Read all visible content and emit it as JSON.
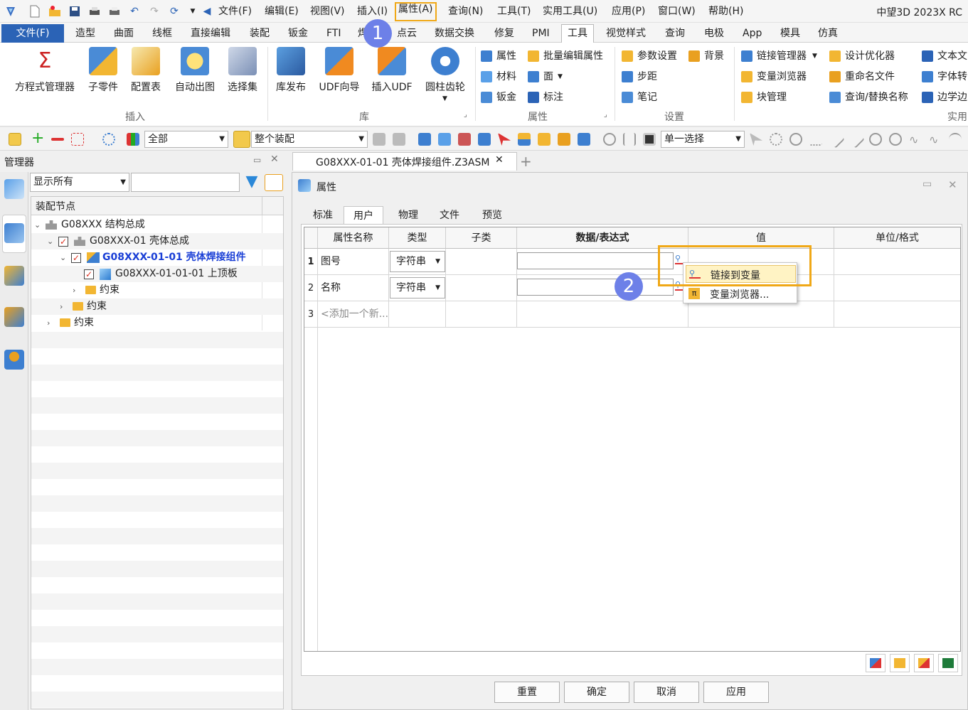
{
  "app_title": "中望3D 2023X RC",
  "menu": [
    "文件(F)",
    "编辑(E)",
    "视图(V)",
    "插入(I)",
    "属性(A)",
    "查询(N)",
    "工具(T)",
    "实用工具(U)",
    "应用(P)",
    "窗口(W)",
    "帮助(H)"
  ],
  "ribbon_tabs": [
    "文件(F)",
    "造型",
    "曲面",
    "线框",
    "直接编辑",
    "装配",
    "钣金",
    "FTI",
    "焊",
    "点云",
    "数据交换",
    "修复",
    "PMI",
    "工具",
    "视觉样式",
    "查询",
    "电极",
    "App",
    "模具",
    "仿真"
  ],
  "ribbon": {
    "insert_group": {
      "label": "插入",
      "buttons": [
        "方程式管理器",
        "子零件",
        "配置表",
        "自动出图",
        "选择集"
      ]
    },
    "library_group": {
      "label": "库",
      "buttons": [
        "库发布",
        "UDF向导",
        "插入UDF",
        "圆柱齿轮"
      ]
    },
    "property_group": {
      "label": "属性",
      "items": [
        "属性",
        "批量编辑属性",
        "材料",
        "面",
        "钣金",
        "标注"
      ]
    },
    "settings_group": {
      "label": "设置",
      "items": [
        "参数设置",
        "背景",
        "步距",
        "笔记"
      ]
    },
    "util_group": {
      "label": "实用",
      "items": [
        "链接管理器",
        "设计优化器",
        "文本文",
        "变量浏览器",
        "重命名文件",
        "字体转",
        "块管理",
        "查询/替换名称",
        "边学边"
      ]
    }
  },
  "toolbar": {
    "filter_value": "全部",
    "scope_value": "整个装配",
    "select_mode": "单一选择"
  },
  "manager": {
    "title": "管理器",
    "display_filter": "显示所有",
    "search_value": "",
    "column_header": "装配节点",
    "tree": [
      {
        "label": "G08XXX 结构总成"
      },
      {
        "label": "G08XXX-01 壳体总成"
      },
      {
        "label": "G08XXX-01-01 壳体焊接组件"
      },
      {
        "label": "G08XXX-01-01-01 上顶板"
      },
      {
        "label": "约束"
      },
      {
        "label": "约束"
      },
      {
        "label": "约束"
      }
    ]
  },
  "document_tab": "G08XXX-01-01 壳体焊接组件.Z3ASM",
  "dialog": {
    "title": "属性",
    "tabs": [
      "标准",
      "用户",
      "物理",
      "文件",
      "预览"
    ],
    "active_tab": "用户",
    "columns": [
      "属性名称",
      "类型",
      "子类",
      "数据/表达式",
      "值",
      "单位/格式"
    ],
    "rows": [
      {
        "num": "1",
        "name": "图号",
        "type": "字符串",
        "subclass": "",
        "expr": "",
        "value": "",
        "unit": ""
      },
      {
        "num": "2",
        "name": "名称",
        "type": "字符串",
        "subclass": "",
        "expr": "",
        "value": "",
        "unit": ""
      },
      {
        "num": "3",
        "name": "<添加一个新...",
        "type": "",
        "subclass": "",
        "expr": "",
        "value": "",
        "unit": ""
      }
    ],
    "buttons": [
      "重置",
      "确定",
      "取消",
      "应用"
    ]
  },
  "context_menu": [
    "链接到变量",
    "变量浏览器..."
  ],
  "badges": [
    "1",
    "2"
  ],
  "colors": {
    "accent": "#2b63b6",
    "highlight": "#f0a817",
    "badge": "#6d80e8",
    "selected_text": "#1a3fd6"
  }
}
